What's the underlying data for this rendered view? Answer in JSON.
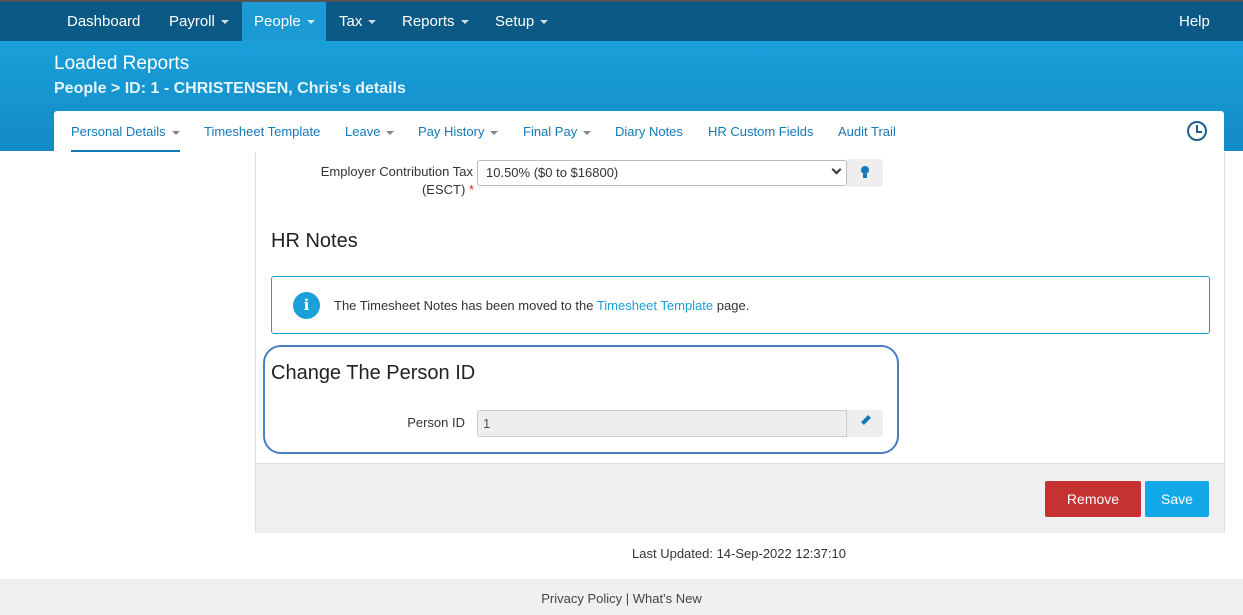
{
  "topnav": {
    "items": [
      {
        "label": "Dashboard"
      },
      {
        "label": "Payroll"
      },
      {
        "label": "People"
      },
      {
        "label": "Tax"
      },
      {
        "label": "Reports"
      },
      {
        "label": "Setup"
      }
    ],
    "help": "Help"
  },
  "header": {
    "title": "Loaded Reports",
    "breadcrumb": "People > ID: 1 - CHRISTENSEN, Chris's details"
  },
  "subtabs": [
    {
      "label": "Personal Details"
    },
    {
      "label": "Timesheet Template"
    },
    {
      "label": "Leave"
    },
    {
      "label": "Pay History"
    },
    {
      "label": "Final Pay"
    },
    {
      "label": "Diary Notes"
    },
    {
      "label": "HR Custom Fields"
    },
    {
      "label": "Audit Trail"
    }
  ],
  "form": {
    "esct_label_line1": "Employer Contribution Tax",
    "esct_label_line2": "(ESCT)",
    "required_mark": "*",
    "esct_value": "10.50% ($0 to $16800)"
  },
  "hr_notes": {
    "heading": "HR Notes",
    "info_icon": "i",
    "info_prefix": "The Timesheet Notes has been moved to the ",
    "info_link": "Timesheet Template",
    "info_suffix": " page."
  },
  "change_id": {
    "heading": "Change The Person ID",
    "label": "Person ID",
    "value": "1"
  },
  "buttons": {
    "remove": "Remove",
    "save": "Save"
  },
  "last_updated": "Last Updated: 14-Sep-2022 12:37:10",
  "footer": {
    "privacy": "Privacy Policy",
    "separator": " | ",
    "whats_new": "What's New"
  },
  "colors": {
    "nav_bg": "#0b5a85",
    "nav_active": "#1b9ad6",
    "header_bg": "#1a9fd9",
    "remove_btn": "#c43232",
    "save_btn": "#13a8e8",
    "highlight_border": "#4a7ec2"
  }
}
